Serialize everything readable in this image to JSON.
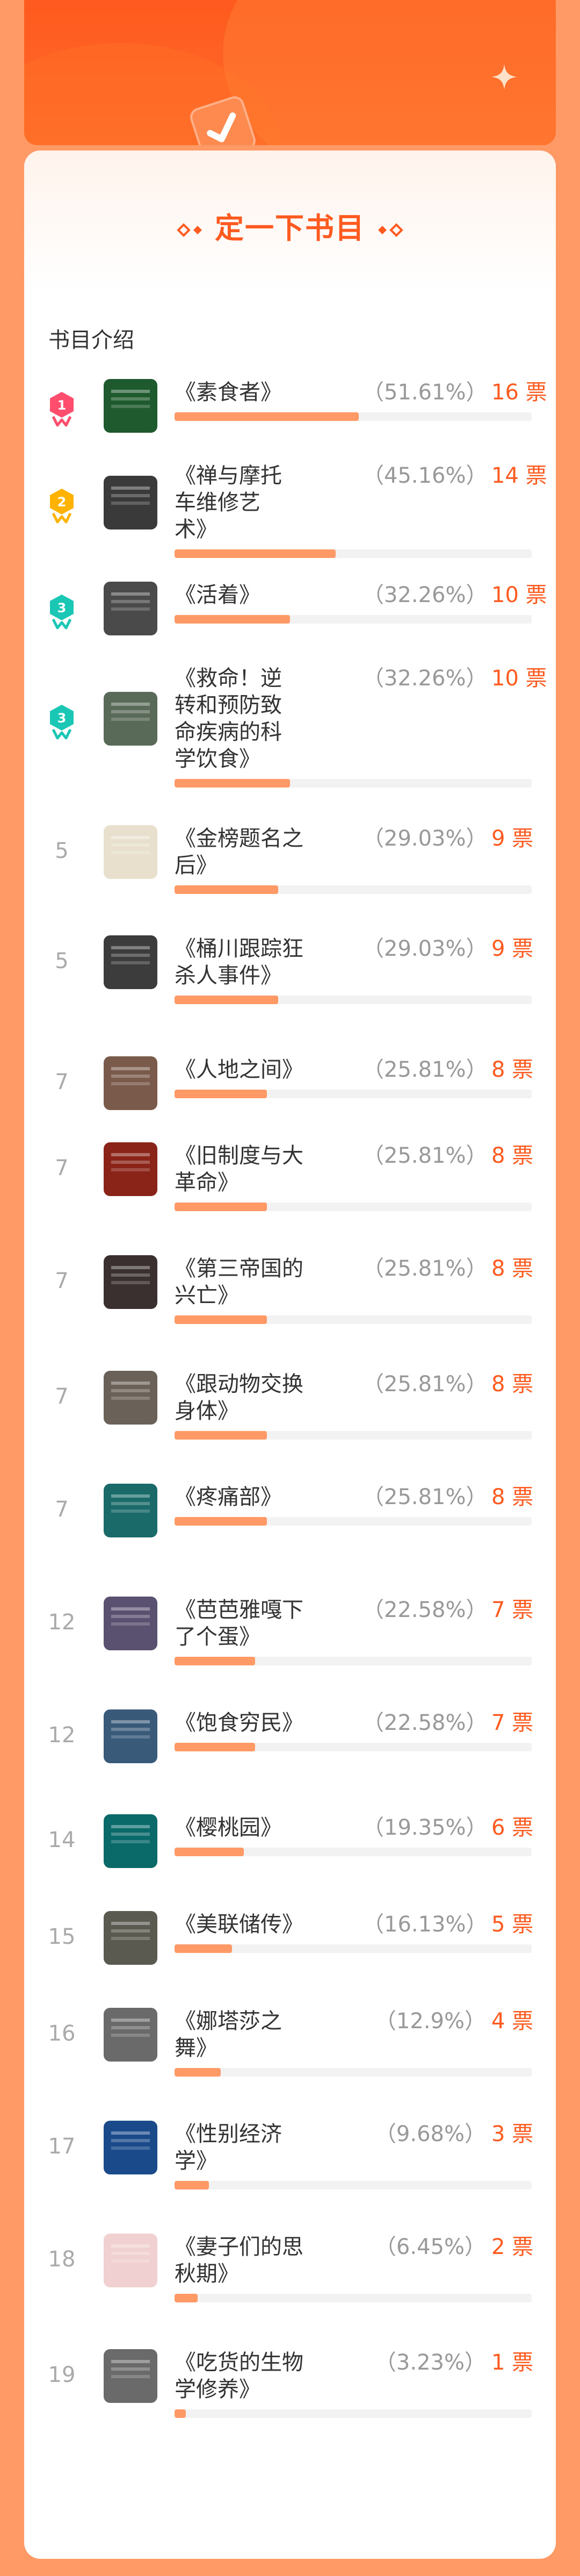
{
  "header": {
    "title": "定一下书目",
    "section_label": "书目介绍"
  },
  "colors": {
    "accent": "#ff5a1f",
    "page_bg": "#ff9966",
    "bar_fill": "#ff9a66",
    "bar_track": "#f2f2f2",
    "medal_gold": "#ffb300",
    "medal_red": "#ff4d6d",
    "medal_teal": "#19c7b4"
  },
  "items": [
    {
      "rank": "1",
      "medal": "red",
      "title_lines": [
        "《素食者》"
      ],
      "pct": "（51.61%）",
      "votes": "16 票",
      "ratio": 0.5161,
      "cover": "#1e5a2e"
    },
    {
      "rank": "2",
      "medal": "gold",
      "title_lines": [
        "《禅与摩托",
        "车维修艺",
        "术》"
      ],
      "pct": "（45.16%）",
      "votes": "14 票",
      "ratio": 0.4516,
      "cover": "#3a3a3a"
    },
    {
      "rank": "3",
      "medal": "teal",
      "title_lines": [
        "《活着》"
      ],
      "pct": "（32.26%）",
      "votes": "10 票",
      "ratio": 0.3226,
      "cover": "#4a4a4a"
    },
    {
      "rank": "3",
      "medal": "teal",
      "title_lines": [
        "《救命！逆",
        "转和预防致",
        "命疾病的科",
        "学饮食》"
      ],
      "pct": "（32.26%）",
      "votes": "10 票",
      "ratio": 0.3226,
      "cover": "#5a6a58"
    },
    {
      "rank": "5",
      "medal": "",
      "title_lines": [
        "《金榜题名之",
        "后》"
      ],
      "pct": "（29.03%）",
      "votes": "9 票",
      "ratio": 0.2903,
      "cover": "#e8e0cc"
    },
    {
      "rank": "5",
      "medal": "",
      "title_lines": [
        "《桶川跟踪狂",
        "杀人事件》"
      ],
      "pct": "（29.03%）",
      "votes": "9 票",
      "ratio": 0.2903,
      "cover": "#3c3c3c"
    },
    {
      "rank": "7",
      "medal": "",
      "title_lines": [
        "《人地之间》"
      ],
      "pct": "（25.81%）",
      "votes": "8 票",
      "ratio": 0.2581,
      "cover": "#7a5a4a"
    },
    {
      "rank": "7",
      "medal": "",
      "title_lines": [
        "《旧制度与大",
        "革命》"
      ],
      "pct": "（25.81%）",
      "votes": "8 票",
      "ratio": 0.2581,
      "cover": "#8a2418"
    },
    {
      "rank": "7",
      "medal": "",
      "title_lines": [
        "《第三帝国的",
        "兴亡》"
      ],
      "pct": "（25.81%）",
      "votes": "8 票",
      "ratio": 0.2581,
      "cover": "#3a3030"
    },
    {
      "rank": "7",
      "medal": "",
      "title_lines": [
        "《跟动物交换",
        "身体》"
      ],
      "pct": "（25.81%）",
      "votes": "8 票",
      "ratio": 0.2581,
      "cover": "#6a6258"
    },
    {
      "rank": "7",
      "medal": "",
      "title_lines": [
        "《疼痛部》"
      ],
      "pct": "（25.81%）",
      "votes": "8 票",
      "ratio": 0.2581,
      "cover": "#1a6a6a"
    },
    {
      "rank": "12",
      "medal": "",
      "title_lines": [
        "《芭芭雅嘎下",
        "了个蛋》"
      ],
      "pct": "（22.58%）",
      "votes": "7 票",
      "ratio": 0.2258,
      "cover": "#5a5070"
    },
    {
      "rank": "12",
      "medal": "",
      "title_lines": [
        "《饱食穷民》"
      ],
      "pct": "（22.58%）",
      "votes": "7 票",
      "ratio": 0.2258,
      "cover": "#3a5a7a"
    },
    {
      "rank": "14",
      "medal": "",
      "title_lines": [
        "《樱桃园》"
      ],
      "pct": "（19.35%）",
      "votes": "6 票",
      "ratio": 0.1935,
      "cover": "#0a6a6a"
    },
    {
      "rank": "15",
      "medal": "",
      "title_lines": [
        "《美联储传》"
      ],
      "pct": "（16.13%）",
      "votes": "5 票",
      "ratio": 0.1613,
      "cover": "#5a5a50"
    },
    {
      "rank": "16",
      "medal": "",
      "title_lines": [
        "《娜塔莎之",
        "舞》"
      ],
      "pct": "（12.9%）",
      "votes": "4 票",
      "ratio": 0.129,
      "cover": "#6a6a6a"
    },
    {
      "rank": "17",
      "medal": "",
      "title_lines": [
        "《性别经济",
        "学》"
      ],
      "pct": "（9.68%）",
      "votes": "3 票",
      "ratio": 0.0968,
      "cover": "#1a4a8a"
    },
    {
      "rank": "18",
      "medal": "",
      "title_lines": [
        "《妻子们的思",
        "秋期》"
      ],
      "pct": "（6.45%）",
      "votes": "2 票",
      "ratio": 0.0645,
      "cover": "#f0d0d0"
    },
    {
      "rank": "19",
      "medal": "",
      "title_lines": [
        "《吃货的生物",
        "学修养》"
      ],
      "pct": "（3.23%）",
      "votes": "1 票",
      "ratio": 0.0323,
      "cover": "#6a6a6a"
    }
  ]
}
